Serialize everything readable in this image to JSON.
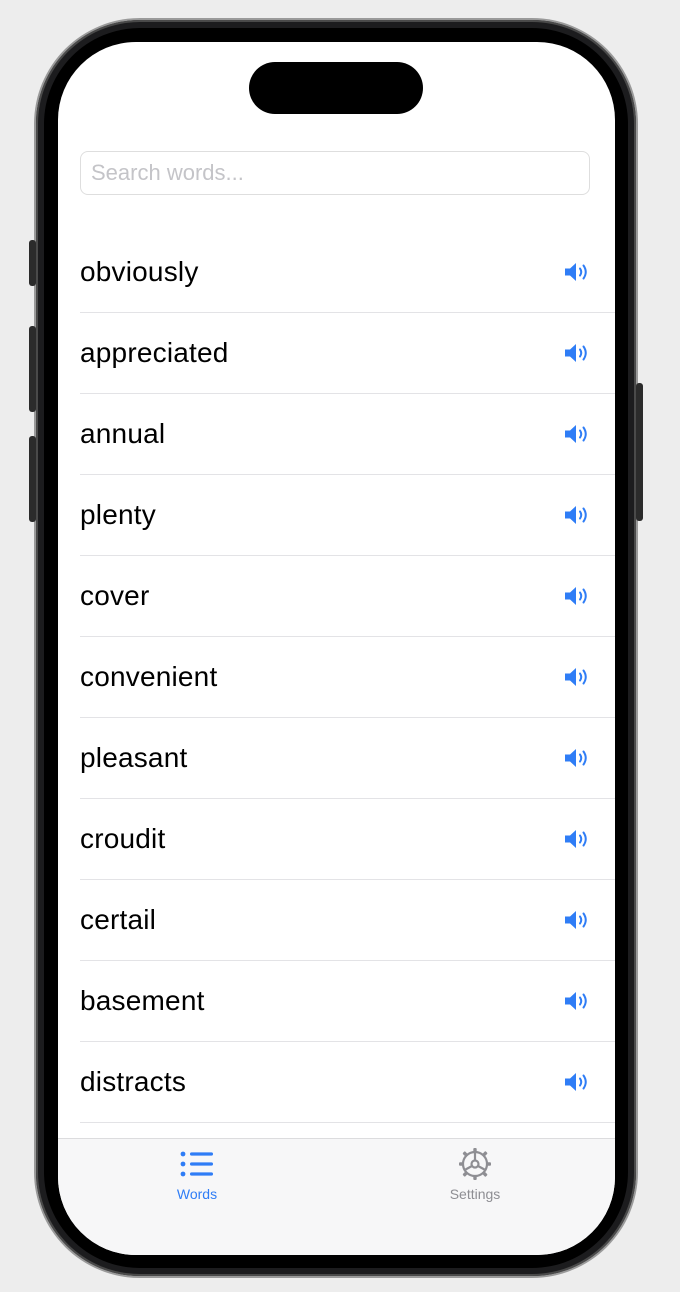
{
  "search": {
    "placeholder": "Search words...",
    "value": ""
  },
  "words": [
    "obviously",
    "appreciated",
    "annual",
    "plenty",
    "cover",
    "convenient",
    "pleasant",
    "croudit",
    "certail",
    "basement",
    "distracts"
  ],
  "row_icon": "speaker-icon",
  "tabs": [
    {
      "label": "Words",
      "icon": "list-icon",
      "active": true
    },
    {
      "label": "Settings",
      "icon": "gear-icon",
      "active": false
    }
  ],
  "colors": {
    "accent": "#2f7df6",
    "inactive": "#8e8e93"
  }
}
